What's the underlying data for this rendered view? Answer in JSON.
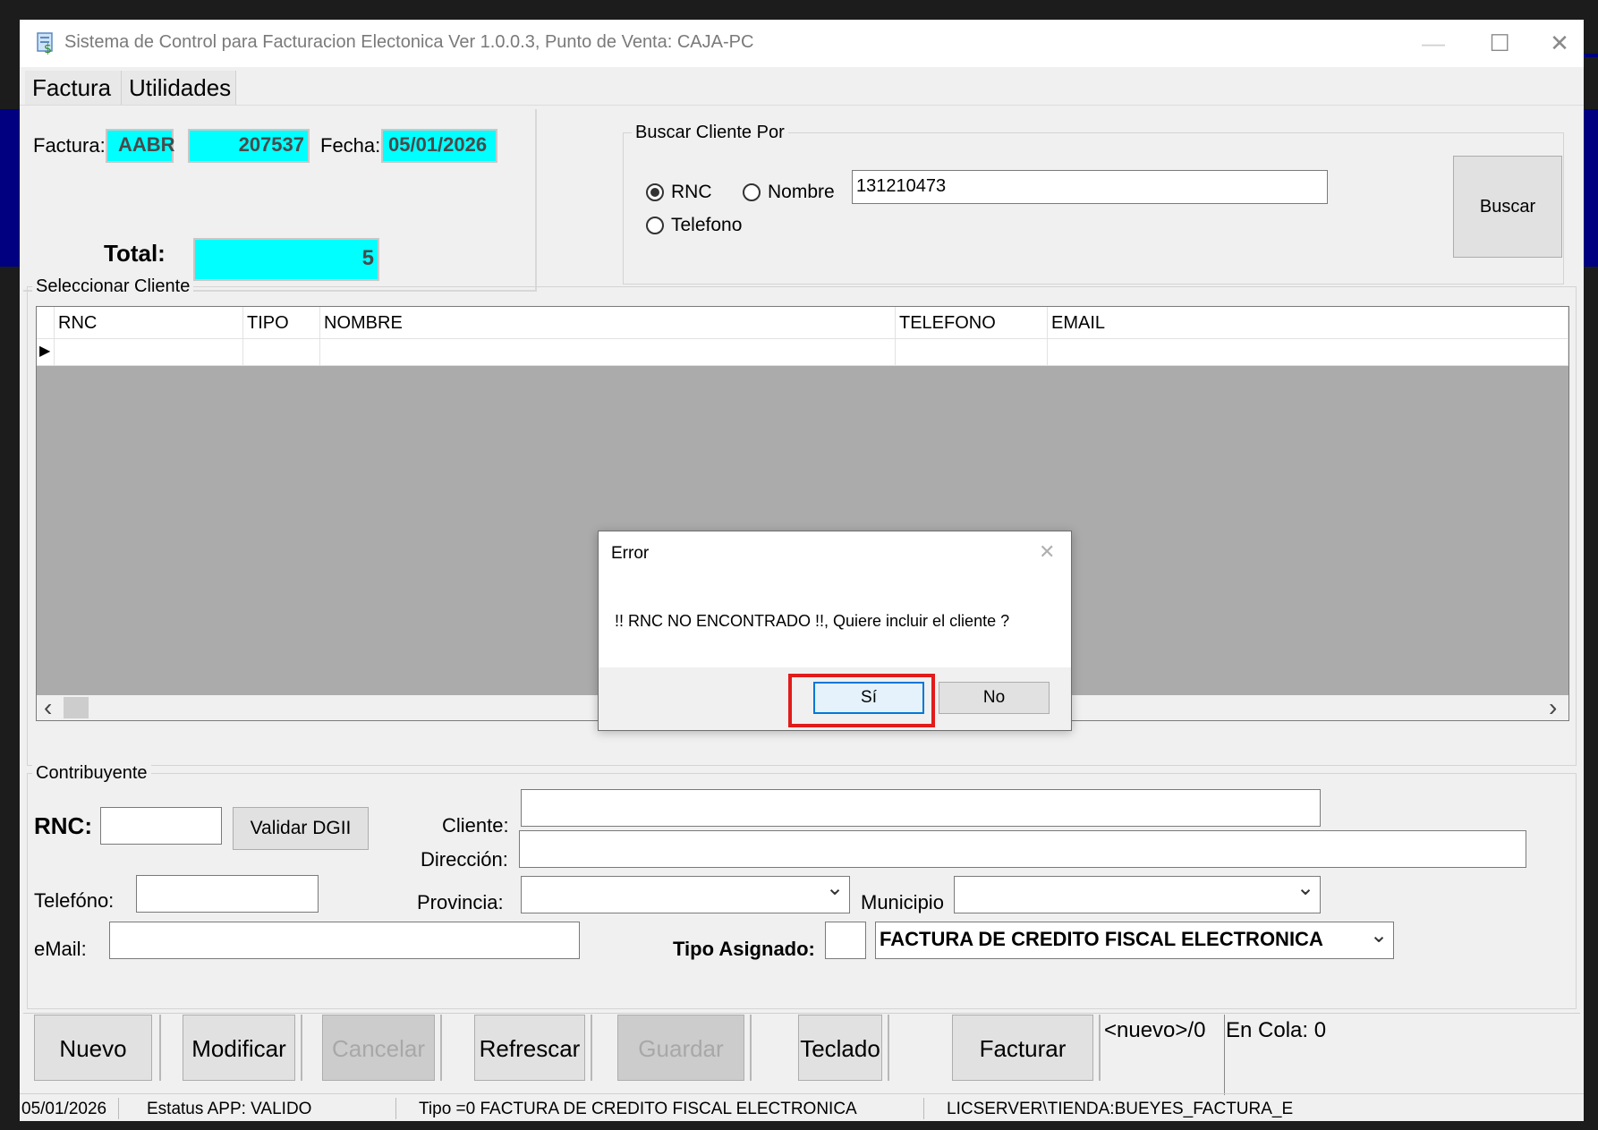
{
  "window": {
    "title": "Sistema de Control para Facturacion Electonica  Ver 1.0.0.3, Punto de Venta: CAJA-PC",
    "min_glyph": "—",
    "max_glyph": "☐",
    "close_glyph": "✕"
  },
  "menu": {
    "items": [
      "Factura",
      "Utilidades"
    ]
  },
  "header": {
    "factura_label": "Factura:",
    "serie": "AABR",
    "numero": "207537",
    "fecha_label": "Fecha:",
    "fecha": "05/01/2026",
    "total_label": "Total:",
    "total": "5"
  },
  "buscar": {
    "group_title": "Buscar Cliente Por",
    "options": [
      "RNC",
      "Nombre",
      "Telefono"
    ],
    "selected": "RNC",
    "query": "131210473",
    "button": "Buscar"
  },
  "clientes": {
    "group_title": "Seleccionar Cliente",
    "columns": [
      "RNC",
      "TIPO",
      "NOMBRE",
      "TELEFONO",
      "EMAIL"
    ],
    "row_marker": "▶",
    "scroll_left": "‹",
    "scroll_right": "›"
  },
  "contribuyente": {
    "group_title": "Contribuyente",
    "rnc_label": "RNC:",
    "rnc_value": "",
    "validar_button": "Validar DGII",
    "cliente_label": "Cliente:",
    "direccion_label": "Dirección:",
    "telefono_label": "Telefóno:",
    "provincia_label": "Provincia:",
    "municipio_label": "Municipio",
    "email_label": "eMail:",
    "tipo_label": "Tipo Asignado:",
    "tipo_value": "FACTURA DE CREDITO FISCAL ELECTRONICA",
    "dropdown_glyph": "⌄"
  },
  "toolbar": {
    "nuevo": "Nuevo",
    "modificar": "Modificar",
    "cancelar": "Cancelar",
    "refrescar": "Refrescar",
    "guardar": "Guardar",
    "teclado": "Teclado",
    "facturar": "Facturar",
    "estado": "<nuevo>/0",
    "cola": "En Cola: 0"
  },
  "dialog": {
    "title": "Error",
    "close_glyph": "✕",
    "message": "!! RNC NO ENCONTRADO !!, Quiere incluir el cliente ?",
    "yes": "Sí",
    "no": "No"
  },
  "statusbar": {
    "fecha": "05/01/2026",
    "estatus": "Estatus APP: VALIDO",
    "tipo": "Tipo =0 FACTURA DE CREDITO FISCAL ELECTRONICA",
    "server": "LICSERVER\\TIENDA:BUEYES_FACTURA_E"
  },
  "colors": {
    "cyan_field": "#00ffff",
    "highlight": "#e21b1b",
    "background_band": "#000080"
  }
}
